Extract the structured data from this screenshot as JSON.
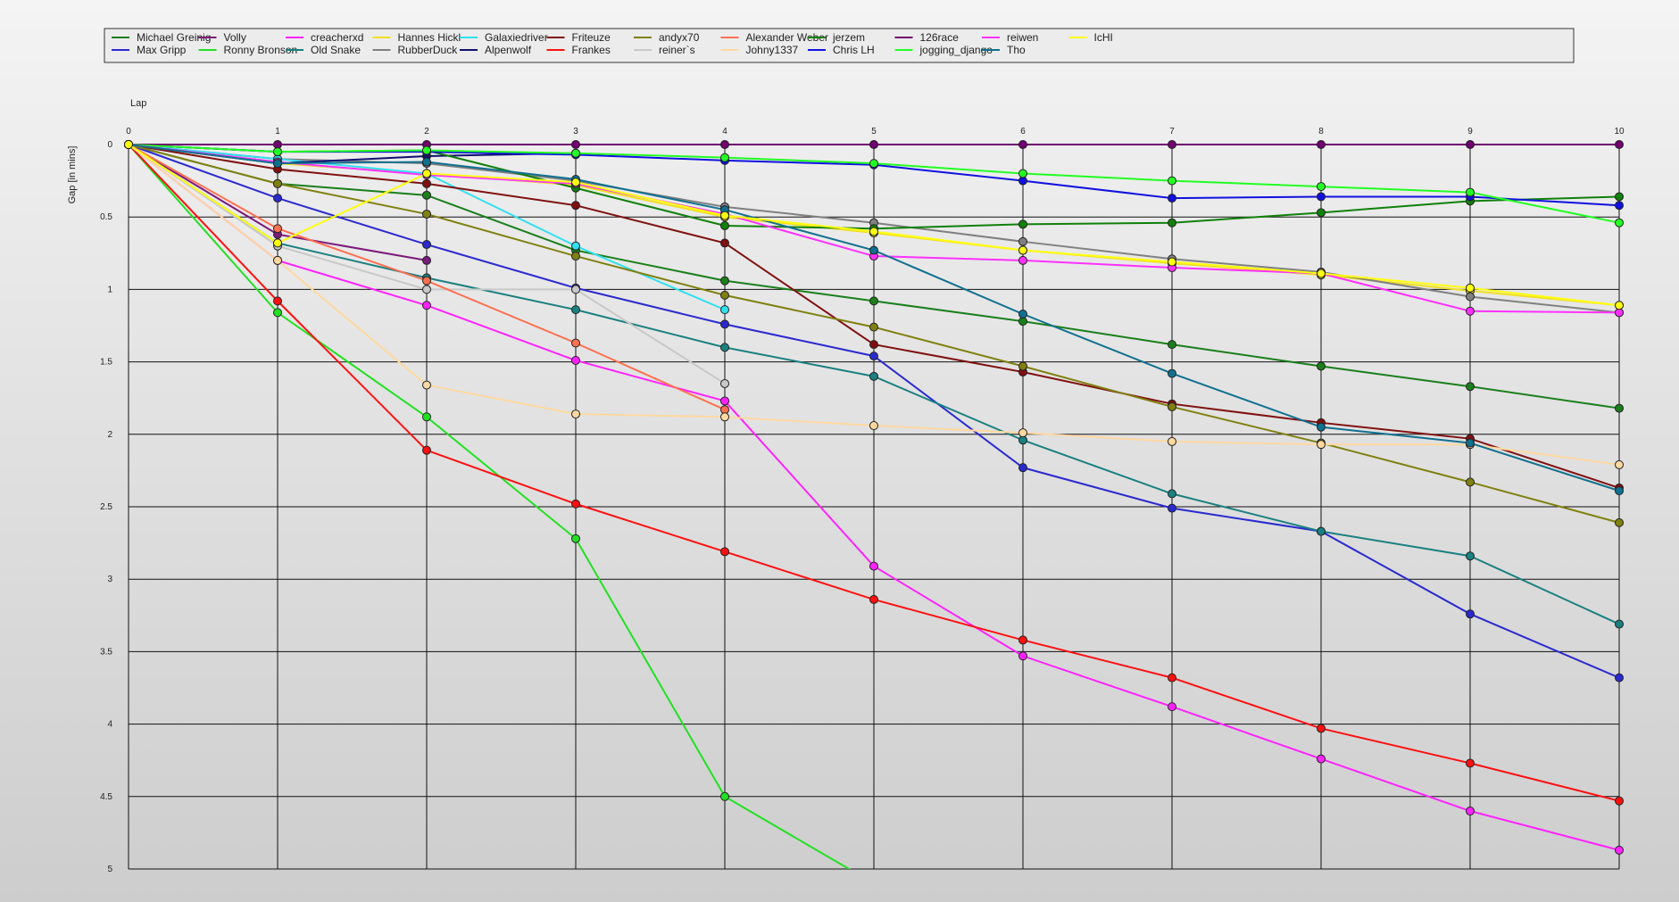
{
  "chart_data": {
    "type": "line",
    "title": "",
    "xlabel": "Lap",
    "ylabel": "Gap [in mins]",
    "x": [
      0,
      1,
      2,
      3,
      4,
      5,
      6,
      7,
      8,
      9,
      10
    ],
    "xlim": [
      0,
      10
    ],
    "ylim": [
      0,
      5
    ],
    "y_inverted": true,
    "y_ticks": [
      "0",
      "0.5",
      "1",
      "1.5",
      "2",
      "2.5",
      "3",
      "3.5",
      "4",
      "4.5",
      "5"
    ],
    "grid": true,
    "legend_position": "top",
    "series": [
      {
        "name": "Michael Greinig",
        "color": "#1a7f1a",
        "values": [
          0,
          0.27,
          0.35,
          0.73,
          0.94,
          1.08,
          1.22,
          1.38,
          1.53,
          1.67,
          1.82
        ]
      },
      {
        "name": "Max Gripp",
        "color": "#2a2ad0",
        "values": [
          0,
          0.37,
          0.69,
          0.99,
          1.24,
          1.46,
          2.23,
          2.51,
          2.67,
          3.24,
          3.68
        ]
      },
      {
        "name": "Volly",
        "color": "#7a1a7a",
        "values": [
          0,
          0.62,
          0.8
        ]
      },
      {
        "name": "Ronny Bronson",
        "color": "#22e022",
        "values": [
          0,
          1.16,
          1.88,
          2.72,
          4.5,
          5.1
        ]
      },
      {
        "name": "creacherxd",
        "color": "#ff22ff",
        "values": [
          0,
          0.8,
          1.11,
          1.49,
          1.77,
          2.91,
          3.53,
          3.88,
          4.24,
          4.6,
          4.87
        ]
      },
      {
        "name": "Old Snake",
        "color": "#1a8080",
        "values": [
          0,
          0.68,
          0.92,
          1.14,
          1.4,
          1.6,
          2.04,
          2.41,
          2.67,
          2.84,
          3.31
        ]
      },
      {
        "name": "Hannes Hickl",
        "color": "#f0e020",
        "values": [
          0,
          0.13,
          0.2,
          0.28,
          0.5,
          0.61,
          0.73,
          0.82,
          0.9,
          1.01,
          1.11
        ]
      },
      {
        "name": "RubberDuck",
        "color": "#808080",
        "values": [
          0,
          0.1,
          0.13,
          0.25,
          0.43,
          0.54,
          0.67,
          0.79,
          0.88,
          1.05,
          1.16
        ]
      },
      {
        "name": "Galaxiedriver",
        "color": "#30e0f0",
        "values": [
          0,
          0.1,
          0.2,
          0.7,
          1.14
        ]
      },
      {
        "name": "Alpenwolf",
        "color": "#101070",
        "values": [
          0,
          0.13,
          0.08,
          0.06
        ]
      },
      {
        "name": "Friteuze",
        "color": "#801010",
        "values": [
          0,
          0.17,
          0.27,
          0.42,
          0.68,
          1.38,
          1.57,
          1.79,
          1.92,
          2.03,
          2.37
        ]
      },
      {
        "name": "Frankes",
        "color": "#ff1010",
        "values": [
          0,
          1.08,
          2.11,
          2.48,
          2.81,
          3.14,
          3.42,
          3.68,
          4.03,
          4.27,
          4.53
        ]
      },
      {
        "name": "andyx70",
        "color": "#808010",
        "values": [
          0,
          0.27,
          0.48,
          0.77,
          1.04,
          1.26,
          1.53,
          1.81,
          2.06,
          2.33,
          2.61
        ]
      },
      {
        "name": "reiner`s",
        "color": "#c8c8c8",
        "values": [
          0,
          0.7,
          1.0,
          1.0,
          1.65
        ]
      },
      {
        "name": "Alexander Weber",
        "color": "#ff7050",
        "values": [
          0,
          0.58,
          0.94,
          1.37,
          1.83
        ]
      },
      {
        "name": "Johny1337",
        "color": "#ffd8a0",
        "values": [
          0,
          0.8,
          1.66,
          1.86,
          1.88,
          1.94,
          1.99,
          2.05,
          2.07,
          2.07,
          2.21
        ]
      },
      {
        "name": "jerzem",
        "color": "#10800a",
        "values": [
          0,
          0.05,
          0.04,
          0.3,
          0.56,
          0.58,
          0.55,
          0.54,
          0.47,
          0.39,
          0.36
        ]
      },
      {
        "name": "Chris LH",
        "color": "#1010e0",
        "values": [
          0,
          0.05,
          0.05,
          0.07,
          0.11,
          0.14,
          0.25,
          0.37,
          0.36,
          0.36,
          0.42
        ]
      },
      {
        "name": "126race",
        "color": "#700070",
        "values": [
          0,
          0,
          0,
          0,
          0,
          0,
          0,
          0,
          0,
          0,
          0
        ]
      },
      {
        "name": "jogging_django",
        "color": "#22ff22",
        "values": [
          0,
          0.05,
          0.04,
          0.06,
          0.09,
          0.13,
          0.2,
          0.25,
          0.29,
          0.33,
          0.54
        ]
      },
      {
        "name": "reiwen",
        "color": "#ff30ff",
        "values": [
          0,
          0.12,
          0.21,
          0.27,
          0.48,
          0.77,
          0.8,
          0.85,
          0.89,
          1.15,
          1.16
        ]
      },
      {
        "name": "Tho",
        "color": "#107090",
        "values": [
          0,
          0.13,
          0.12,
          0.24,
          0.45,
          0.73,
          1.17,
          1.58,
          1.95,
          2.06,
          2.39
        ]
      },
      {
        "name": "IcHI",
        "color": "#ffff10",
        "values": [
          0,
          0.68,
          0.2,
          0.26,
          0.49,
          0.6,
          0.73,
          0.81,
          0.89,
          0.99,
          1.11
        ]
      }
    ]
  }
}
